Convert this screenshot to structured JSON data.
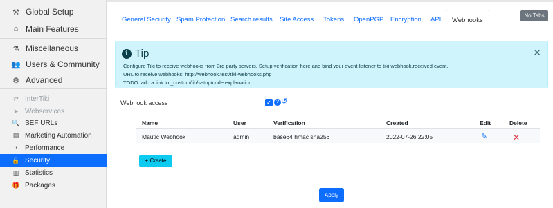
{
  "sidebar": {
    "items": [
      {
        "label": "Global Setup",
        "icon": "wrench-icon",
        "glyph": "⚒"
      },
      {
        "label": "Main Features",
        "icon": "bank-icon",
        "glyph": "⌂"
      },
      {
        "label": "Miscellaneous",
        "icon": "flask-icon",
        "glyph": "⚗"
      },
      {
        "label": "Users & Community",
        "icon": "users-icon",
        "glyph": "👥"
      },
      {
        "label": "Advanced",
        "icon": "cogs-icon",
        "glyph": "⚙"
      },
      {
        "label": "InterTiki",
        "icon": "exchange-icon",
        "glyph": "⇄"
      },
      {
        "label": "Webservices",
        "icon": "mouse-pointer-icon",
        "glyph": "➤"
      },
      {
        "label": "SEF URLs",
        "icon": "magnify-icon",
        "glyph": "🔍"
      },
      {
        "label": "Marketing Automation",
        "icon": "server-icon",
        "glyph": "▤"
      },
      {
        "label": "Performance",
        "icon": "tachometer-icon",
        "glyph": "◔"
      },
      {
        "label": "Security",
        "icon": "lock-icon",
        "glyph": "🔒"
      },
      {
        "label": "Statistics",
        "icon": "chart-icon",
        "glyph": "▥"
      },
      {
        "label": "Packages",
        "icon": "gift-icon",
        "glyph": "🎁"
      }
    ]
  },
  "tabs": [
    {
      "label": "General Security"
    },
    {
      "label": "Spam Protection"
    },
    {
      "label": "Search results"
    },
    {
      "label": "Site Access"
    },
    {
      "label": "Tokens"
    },
    {
      "label": "OpenPGP"
    },
    {
      "label": "Encryption"
    },
    {
      "label": "API"
    },
    {
      "label": "Webhooks"
    }
  ],
  "no_tabs_label": "No Tabs",
  "tip": {
    "title": "Tip",
    "line1": "Configure Tiki to receive webhooks from 3rd party servers. Setup verification here and bind your event listener to tiki.webhook.received event.",
    "line2": "URL to receive webhooks: http://webhook.test/tiki-webhooks.php",
    "line3": "TODO: add a link to _custom/lib/setup/code explanation.",
    "close_glyph": "✕"
  },
  "webhook_access": {
    "label": "Webhook access",
    "checked": true
  },
  "table": {
    "headers": [
      "Name",
      "User",
      "Verification",
      "Created",
      "Edit",
      "Delete"
    ],
    "rows": [
      {
        "name": "Mautic Webhook",
        "user": "admin",
        "verification": "base64 hmac sha256",
        "created": "2022-07-26 22:05"
      }
    ]
  },
  "create_label": "+ Create",
  "apply_label": "Apply",
  "colors": {
    "accent": "#0d6efd",
    "tip_bg": "#cff4fc",
    "create_bg": "#0dcaf0",
    "delete": "#dc3545"
  }
}
